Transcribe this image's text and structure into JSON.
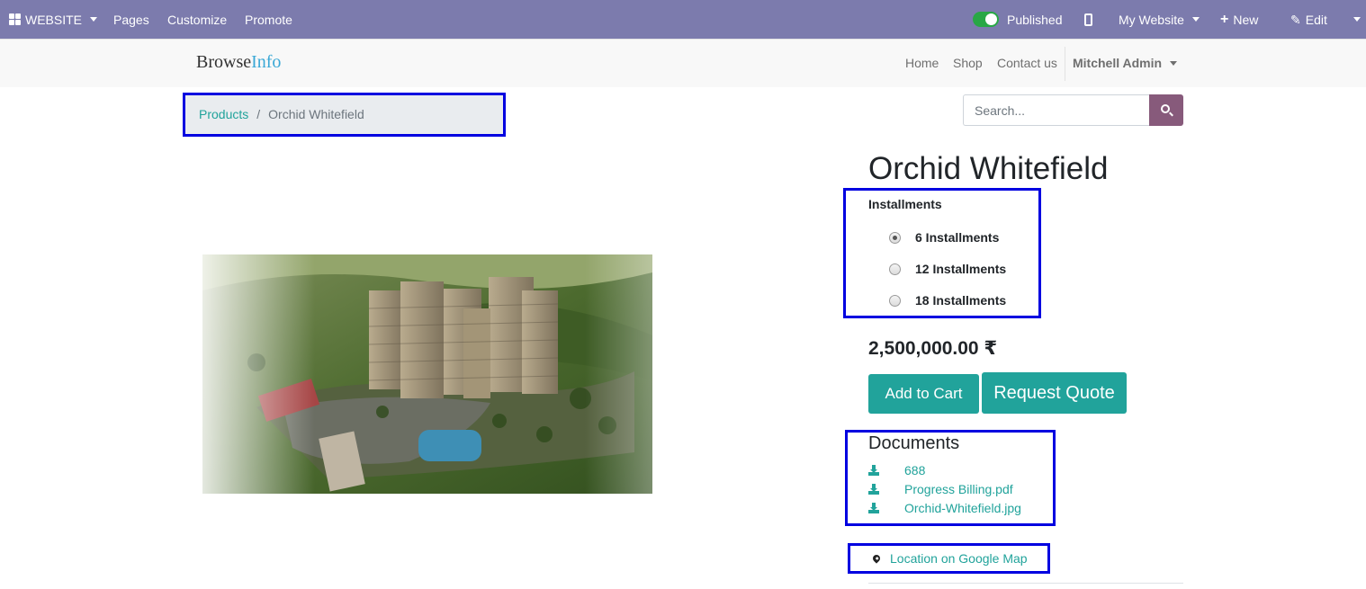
{
  "admin_bar": {
    "website_label": "WEBSITE",
    "pages_label": "Pages",
    "customize_label": "Customize",
    "promote_label": "Promote",
    "published_label": "Published",
    "my_website_label": "My Website",
    "new_label": "New",
    "edit_label": "Edit"
  },
  "header": {
    "logo_main": "Browse",
    "logo_accent": "Info",
    "nav": [
      "Home",
      "Shop",
      "Contact us"
    ],
    "user": "Mitchell Admin"
  },
  "breadcrumb": {
    "parent": "Products",
    "separator": "/",
    "current": "Orchid Whitefield"
  },
  "search": {
    "placeholder": "Search..."
  },
  "product": {
    "title": "Orchid Whitefield",
    "installments_label": "Installments",
    "installment_options": [
      "6 Installments",
      "12 Installments",
      "18 Installments"
    ],
    "selected_installment": "6 Installments",
    "price": "2,500,000.00 ₹",
    "add_to_cart_label": "Add to Cart",
    "request_quote_label": "Request Quote"
  },
  "documents": {
    "title": "Documents",
    "files": [
      "688",
      "Progress Billing.pdf",
      "Orchid-Whitefield.jpg"
    ]
  },
  "location": {
    "label": "Location on Google Map"
  },
  "colors": {
    "admin_bar": "#7c7bad",
    "accent": "#21a39b",
    "search_button": "#875a7b",
    "highlight_box": "#0000e0"
  }
}
